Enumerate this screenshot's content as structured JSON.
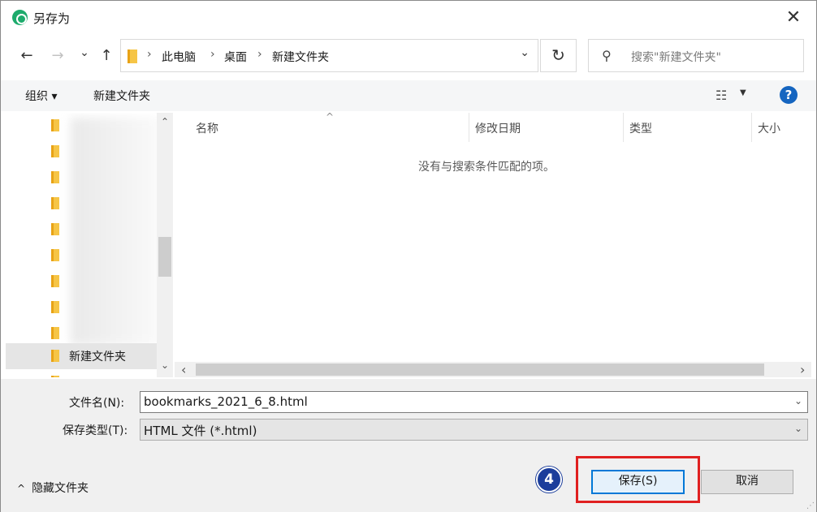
{
  "window": {
    "title": "另存为",
    "close_glyph": "✕"
  },
  "nav": {
    "back_glyph": "←",
    "forward_glyph": "→",
    "recent_glyph": "⌄",
    "up_glyph": "↑",
    "breadcrumbs": [
      "此电脑",
      "桌面",
      "新建文件夹"
    ],
    "separator": "›",
    "dropdown_glyph": "⌄",
    "refresh_glyph": "↻"
  },
  "search": {
    "placeholder": "搜索\"新建文件夹\"",
    "icon": "search-icon"
  },
  "toolbar": {
    "organize_label": "组织 ▾",
    "new_folder_label": "新建文件夹",
    "view_glyph": "☷",
    "view_caret": "▼",
    "help_glyph": "?"
  },
  "tree": {
    "selected_label": "新建文件夹",
    "scroll_up": "⌃",
    "scroll_down": "⌄"
  },
  "filelist": {
    "columns": [
      "名称",
      "修改日期",
      "类型",
      "大小"
    ],
    "sort_caret": "^",
    "empty_message": "没有与搜索条件匹配的项。",
    "scroll_left": "‹",
    "scroll_right": "›"
  },
  "form": {
    "filename_label": "文件名(N):",
    "filename_value": "bookmarks_2021_6_8.html",
    "filetype_label": "保存类型(T):",
    "filetype_value": "HTML 文件 (*.html)",
    "caret": "⌄"
  },
  "footer": {
    "hide_folders_caret": "^",
    "hide_folders_label": "隐藏文件夹",
    "step_number": "4",
    "save_label": "保存(S)",
    "cancel_label": "取消",
    "resize_glyph": "⋰"
  },
  "colors": {
    "accent": "#0078d7",
    "highlight": "#e02020",
    "badge": "#1b3d9b",
    "app_icon": "#1dab6c",
    "help": "#1565c0"
  }
}
